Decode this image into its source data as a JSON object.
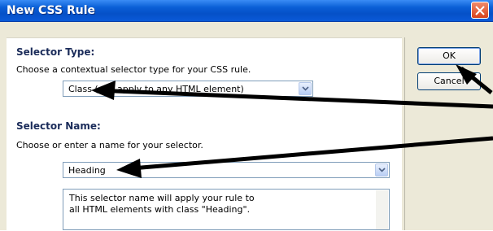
{
  "window": {
    "title": "New CSS Rule"
  },
  "selector_type": {
    "heading": "Selector Type:",
    "description": "Choose a contextual selector type for your CSS rule.",
    "selected": "Class (can apply to any HTML element)"
  },
  "selector_name": {
    "heading": "Selector Name:",
    "description": "Choose or enter a name for your selector.",
    "value": "Heading",
    "info_line1": "This selector name will apply your rule to",
    "info_line2": "all HTML elements with class \"Heading\"."
  },
  "buttons": {
    "ok": "OK",
    "cancel": "Cancel"
  },
  "icons": [
    "close-icon",
    "chevron-down-icon",
    "annotation-arrow"
  ],
  "colors": {
    "titlebar": "#0a5fd6",
    "dialog_bg": "#ece9d8",
    "heading_text": "#1b2c5a"
  }
}
